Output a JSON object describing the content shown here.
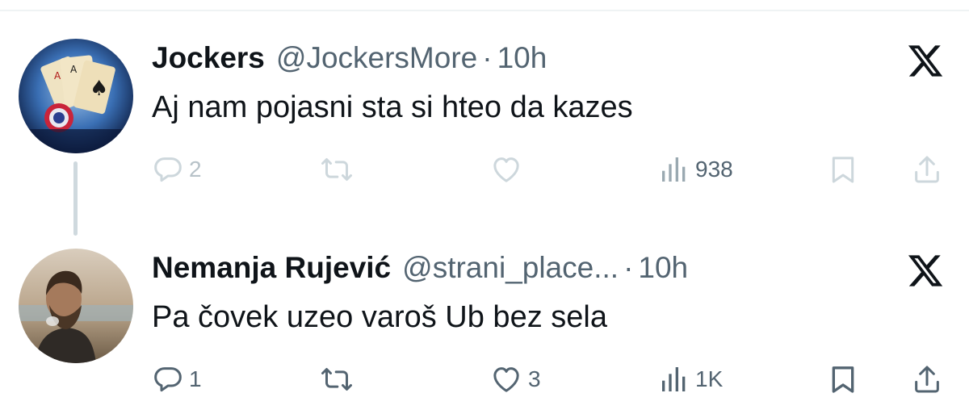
{
  "tweets": [
    {
      "name": "Jockers",
      "handle": "@JockersMore",
      "separator": "·",
      "time": "10h",
      "text": "Aj nam pojasni sta si hteo da kazes",
      "actions": {
        "replies": "2",
        "reposts": "",
        "likes": "",
        "views": "938"
      }
    },
    {
      "name": "Nemanja Rujević",
      "handle": "@strani_place...",
      "separator": "·",
      "time": "10h",
      "text": "Pa čovek uzeo varoš Ub bez sela",
      "actions": {
        "replies": "1",
        "reposts": "",
        "likes": "3",
        "views": "1K"
      }
    }
  ],
  "icons": {
    "reply": "reply-icon",
    "repost": "repost-icon",
    "like": "like-icon",
    "views": "views-icon",
    "bookmark": "bookmark-icon",
    "share": "share-icon",
    "platform": "x-logo-icon"
  },
  "colors": {
    "text": "#0f1419",
    "secondary": "#536471",
    "thread_line": "#cfd9de"
  }
}
